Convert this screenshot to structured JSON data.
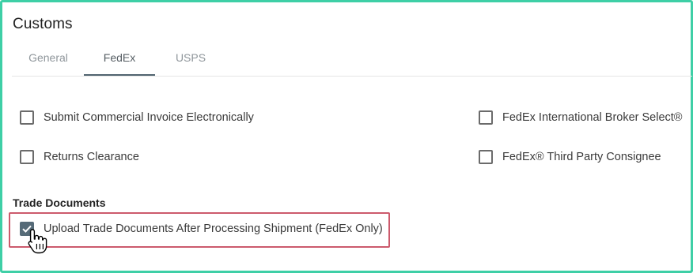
{
  "panel": {
    "title": "Customs"
  },
  "tabs": [
    {
      "label": "General",
      "active": false
    },
    {
      "label": "FedEx",
      "active": true
    },
    {
      "label": "USPS",
      "active": false
    }
  ],
  "options": {
    "submit_invoice": {
      "label": "Submit Commercial Invoice Electronically",
      "checked": false
    },
    "returns_clearance": {
      "label": "Returns Clearance",
      "checked": false
    },
    "broker_select": {
      "label": "FedEx International Broker Select®",
      "checked": false
    },
    "third_party_consignee": {
      "label": "FedEx® Third Party Consignee",
      "checked": false
    }
  },
  "trade_documents": {
    "heading": "Trade Documents",
    "upload": {
      "label": "Upload Trade Documents After Processing Shipment (FedEx Only)",
      "checked": true
    }
  },
  "colors": {
    "frame_border": "#3ecfa6",
    "active_tab_underline": "#516470",
    "checkbox_checked": "#566b78",
    "highlight": "#cc5a6c"
  },
  "icons": {
    "checkmark": "check-icon",
    "pointer": "hand-pointer-icon"
  }
}
